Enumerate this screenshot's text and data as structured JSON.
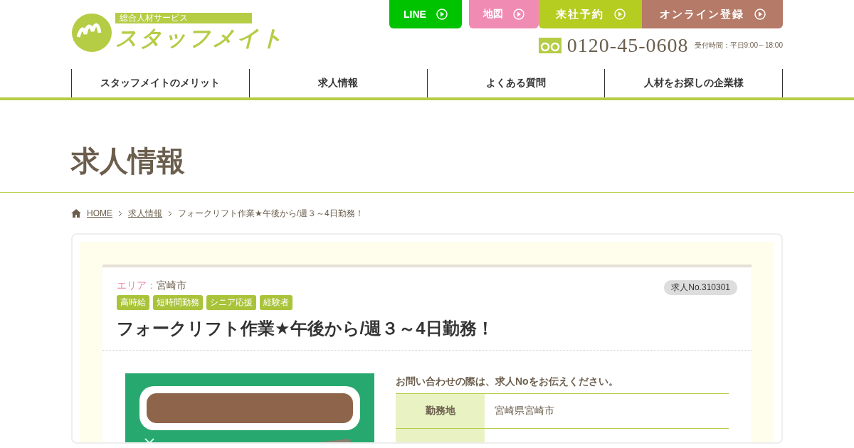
{
  "logo": {
    "tagline": "総合人材サービス",
    "name": "スタッフメイト"
  },
  "header_buttons": [
    {
      "kind": "line",
      "label": "LINE"
    },
    {
      "kind": "map",
      "label": "地図"
    },
    {
      "kind": "visit",
      "label": "来社予約"
    },
    {
      "kind": "online",
      "label": "オンライン登録"
    }
  ],
  "phone": {
    "number": "0120-45-0608",
    "hours": "受付時間：平日9:00～18:00"
  },
  "nav": [
    "スタッフメイトのメリット",
    "求人情報",
    "よくある質問",
    "人材をお探しの企業様"
  ],
  "page_title": "求人情報",
  "breadcrumb": [
    {
      "label": "HOME",
      "link": true
    },
    {
      "label": "求人情報",
      "link": true
    },
    {
      "label": "フォークリフト作業★午後から/週３～4日勤務！",
      "link": false
    }
  ],
  "job": {
    "area_label": "エリア：",
    "area": "宮崎市",
    "job_no": "求人No.310301",
    "tags": [
      "高時給",
      "短時間勤務",
      "シニア応援",
      "経験者"
    ],
    "title": "フォークリフト作業★午後から/週３～4日勤務！",
    "notice": "お問い合わせの際は、求人Noをお伝えください。",
    "details": [
      {
        "label": "勤務地",
        "value": "宮崎県宮崎市"
      }
    ]
  }
}
